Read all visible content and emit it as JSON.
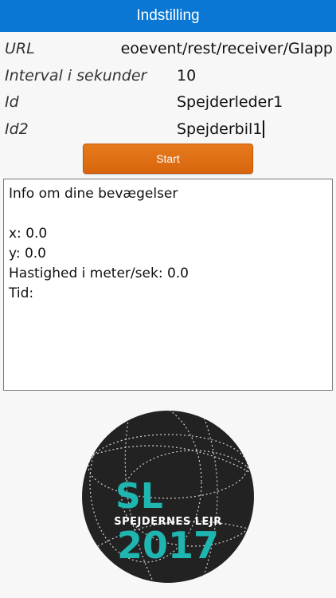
{
  "header": {
    "title": "Indstilling"
  },
  "form": {
    "url": {
      "label": "URL",
      "value": "eoevent/rest/receiver/GIapp"
    },
    "interval": {
      "label": "Interval i sekunder",
      "value": "10"
    },
    "id": {
      "label": "Id",
      "value": "Spejderleder1"
    },
    "id2": {
      "label": "Id2",
      "value": "Spejderbil1"
    }
  },
  "start_button": {
    "label": "Start"
  },
  "info": {
    "heading": "Info om dine bevægelser",
    "x_label": "x: 0.0",
    "y_label": "y: 0.0",
    "speed_label": "Hastighed i meter/sek: 0.0",
    "time_label": "Tid:"
  },
  "logo": {
    "sl": "SL",
    "text": "SPEJDERNES LEJR",
    "year": "2017",
    "colors": {
      "background": "#222222",
      "accent": "#1fb5b0",
      "text": "#ffffff"
    }
  }
}
